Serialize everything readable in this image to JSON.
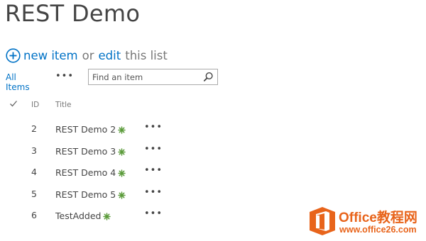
{
  "page": {
    "title": "REST Demo"
  },
  "toolbar": {
    "new_item_label": "new item",
    "or_label": "or",
    "edit_label": "edit",
    "list_label": "this list"
  },
  "view": {
    "current_view": "All Items",
    "more_label": "•••",
    "search_placeholder": "Find an item"
  },
  "list": {
    "columns": {
      "id": "ID",
      "title": "Title"
    },
    "rows": [
      {
        "id": "2",
        "title": "REST Demo 2",
        "is_new": true
      },
      {
        "id": "3",
        "title": "REST Demo 3",
        "is_new": true
      },
      {
        "id": "4",
        "title": "REST Demo 4",
        "is_new": true
      },
      {
        "id": "5",
        "title": "REST Demo 5",
        "is_new": true
      },
      {
        "id": "6",
        "title": "TestAdded",
        "is_new": true
      }
    ],
    "row_menu_label": "•••"
  },
  "watermark": {
    "name": "Office教程网",
    "url": "www.office26.com"
  },
  "colors": {
    "link": "#0072c6",
    "new_badge": "#5b9b3a",
    "watermark": "#e8641b"
  }
}
